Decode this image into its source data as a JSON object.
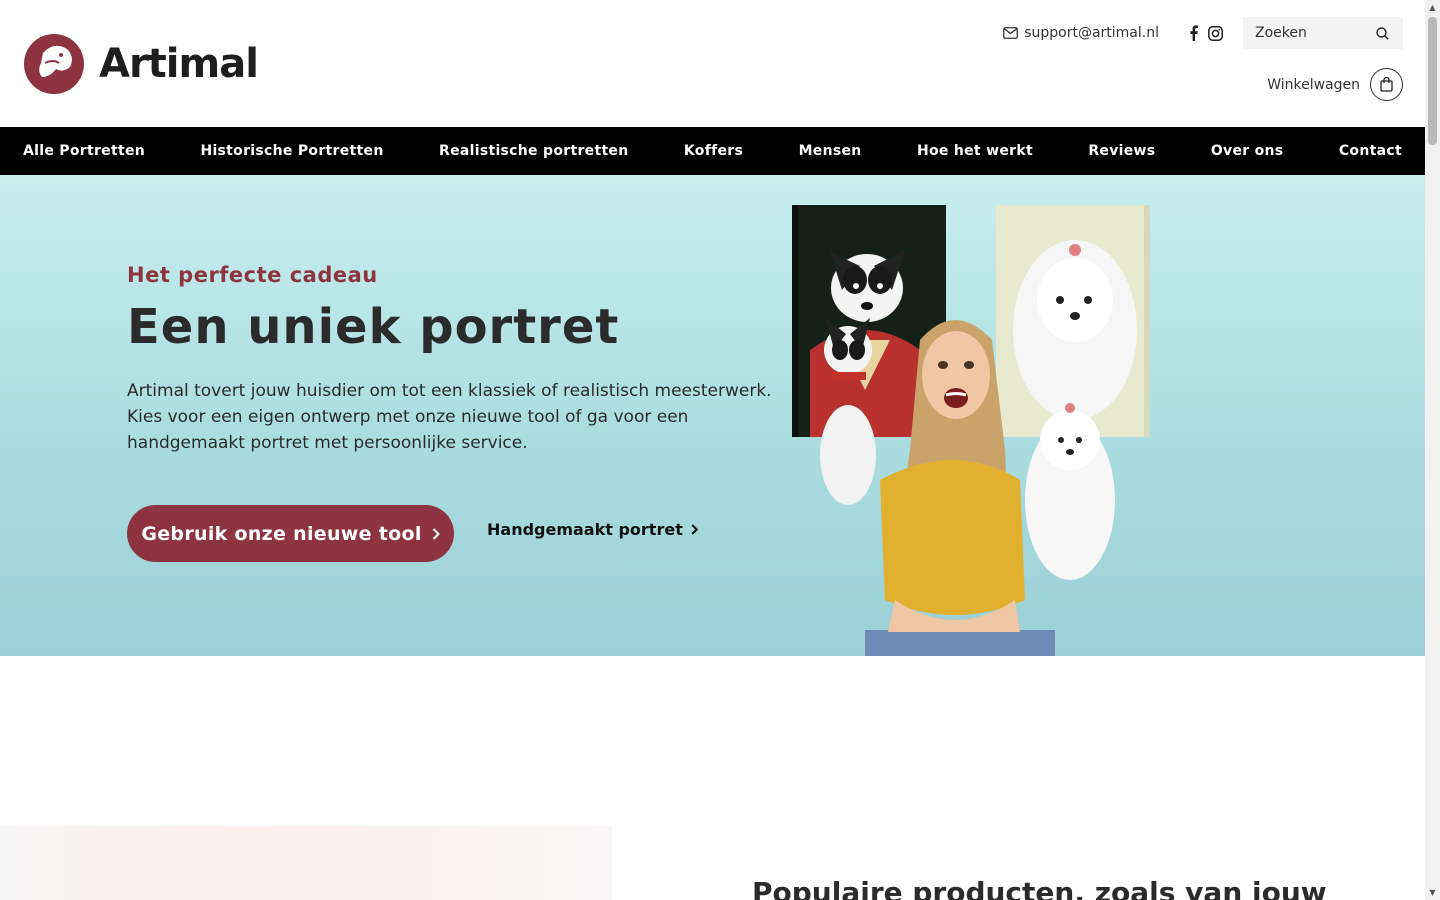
{
  "brand": {
    "name": "Artimal",
    "color": "#8d3440"
  },
  "header": {
    "support_email": "support@artimal.nl",
    "search_placeholder": "Zoeken",
    "cart_label": "Winkelwagen"
  },
  "nav": {
    "items": [
      {
        "label": "Alle Portretten"
      },
      {
        "label": "Historische Portretten"
      },
      {
        "label": "Realistische portretten"
      },
      {
        "label": "Koffers"
      },
      {
        "label": "Mensen"
      },
      {
        "label": "Hoe het werkt"
      },
      {
        "label": "Reviews"
      },
      {
        "label": "Over ons"
      },
      {
        "label": "Contact"
      }
    ]
  },
  "hero": {
    "subtitle": "Het perfecte cadeau",
    "title": "Een uniek portret",
    "description_lines": [
      "Artimal tovert jouw huisdier om tot een klassiek of realistisch meesterwerk.",
      "Kies voor een eigen ontwerp met onze nieuwe tool of ga voor een",
      "handgemaakt portret met persoonlijke service."
    ],
    "primary_cta": "Gebruik onze nieuwe tool",
    "secondary_cta": "Handgemaakt portret"
  },
  "section": {
    "heading": "Populaire producten, zoals van jouw"
  },
  "icons": {
    "mail": "mail-icon",
    "facebook": "facebook-icon",
    "instagram": "instagram-icon",
    "search": "search-icon",
    "cart": "shopping-bag-icon",
    "chevron": "chevron-right-icon"
  }
}
